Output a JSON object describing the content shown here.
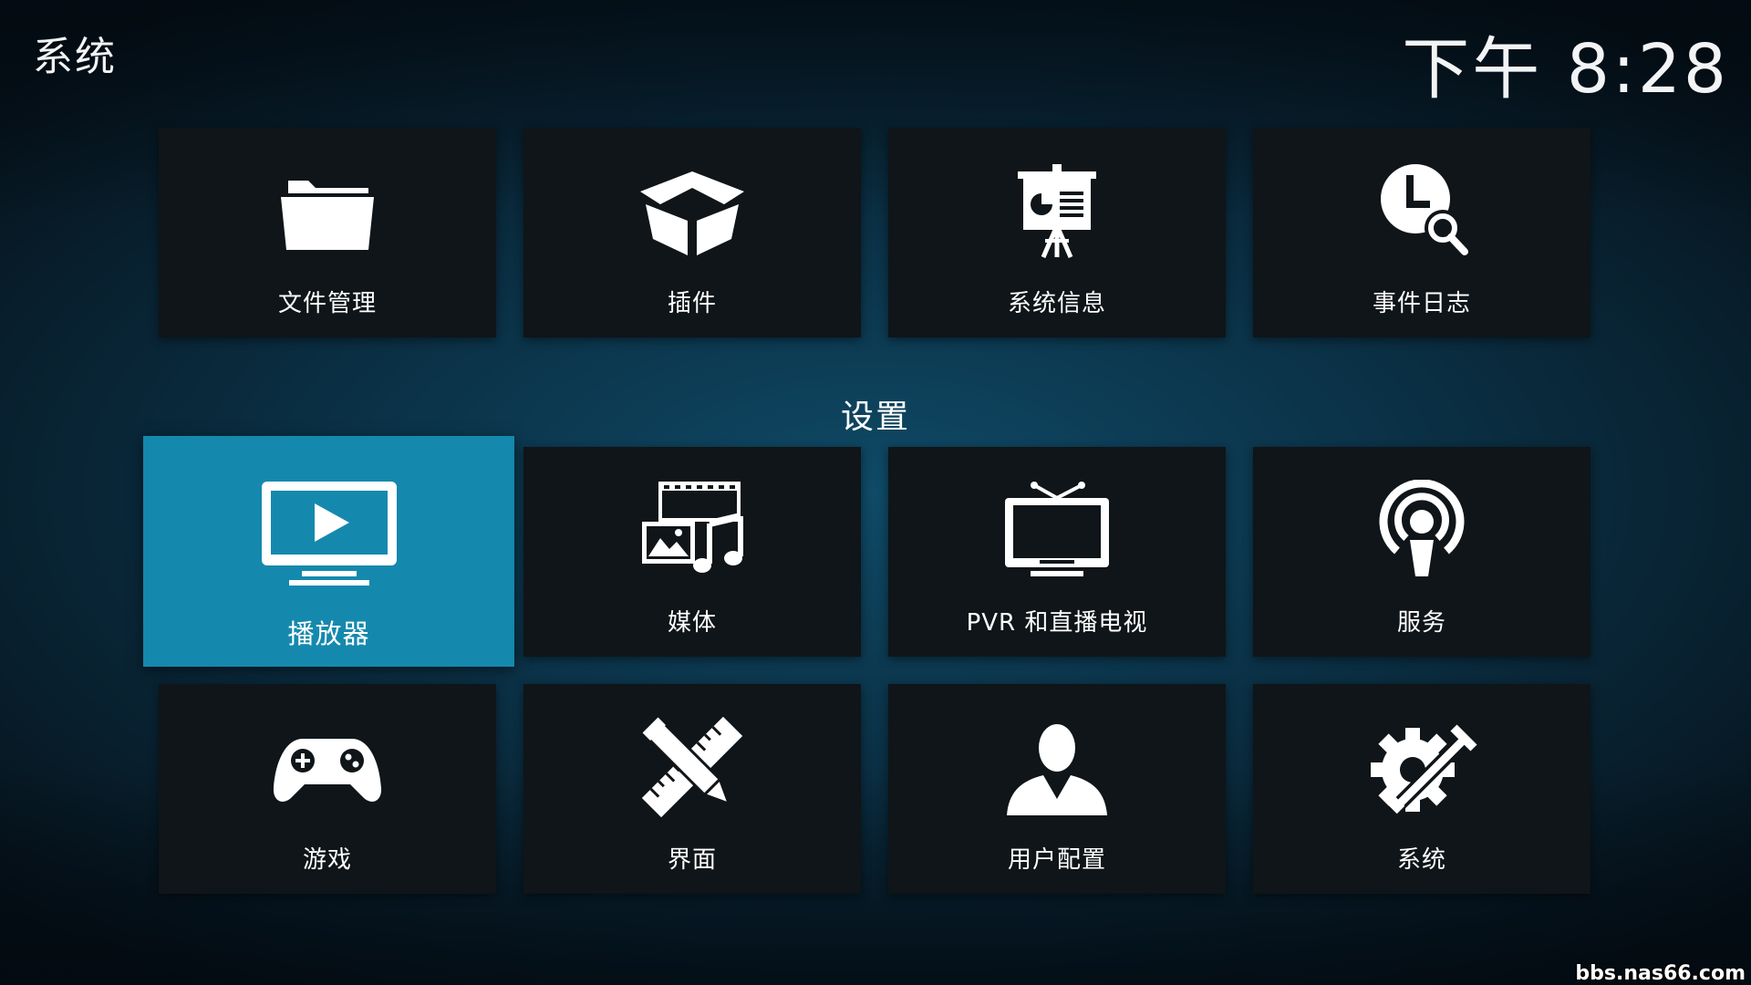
{
  "header": {
    "title": "系统",
    "clock": "下午 8:28"
  },
  "top_row": [
    {
      "label": "文件管理",
      "icon": "folder-icon"
    },
    {
      "label": "插件",
      "icon": "box-icon"
    },
    {
      "label": "系统信息",
      "icon": "presentation-icon"
    },
    {
      "label": "事件日志",
      "icon": "clock-search-icon"
    }
  ],
  "settings": {
    "section_title": "设置",
    "items": [
      {
        "label": "播放器",
        "icon": "tv-play-icon",
        "focused": true
      },
      {
        "label": "媒体",
        "icon": "media-icon"
      },
      {
        "label": "PVR 和直播电视",
        "icon": "tv-antenna-icon"
      },
      {
        "label": "服务",
        "icon": "podcast-icon"
      },
      {
        "label": "游戏",
        "icon": "gamepad-icon"
      },
      {
        "label": "界面",
        "icon": "pencil-ruler-icon"
      },
      {
        "label": "用户配置",
        "icon": "user-icon"
      },
      {
        "label": "系统",
        "icon": "gear-tools-icon"
      }
    ]
  },
  "colors": {
    "focus": "#1589ad",
    "tile": "#0f1518"
  },
  "watermark": "bbs.nas66.com"
}
